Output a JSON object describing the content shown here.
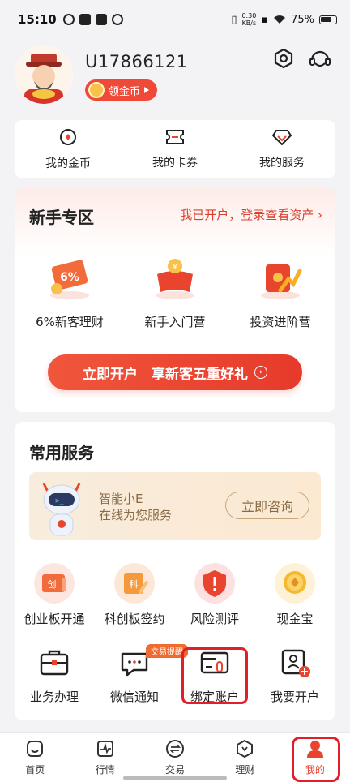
{
  "status_bar": {
    "time": "15:10",
    "net_speed_value": "0.30",
    "net_speed_unit": "KB/s",
    "battery": "75%"
  },
  "profile": {
    "username": "U17866121",
    "coin_badge_label": "领金币"
  },
  "quick_links": [
    {
      "label": "我的金币",
      "icon": "coin-target-icon"
    },
    {
      "label": "我的卡券",
      "icon": "ticket-icon"
    },
    {
      "label": "我的服务",
      "icon": "diamond-icon"
    }
  ],
  "newbie": {
    "title": "新手专区",
    "link": "我已开户，登录查看资产 ›",
    "features": [
      {
        "label": "6%新客理财",
        "icon": "percent-ticket-icon"
      },
      {
        "label": "新手入门营",
        "icon": "book-coin-icon"
      },
      {
        "label": "投资进阶营",
        "icon": "growth-envelope-icon"
      }
    ],
    "cta": "立即开户　享新客五重好礼"
  },
  "services": {
    "title": "常用服务",
    "assistant": {
      "line1": "智能小E",
      "line2": "在线为您服务",
      "button": "立即咨询"
    },
    "row1": [
      {
        "label": "创业板开通",
        "icon": "chuang-icon"
      },
      {
        "label": "科创板签约",
        "icon": "ke-icon"
      },
      {
        "label": "风险测评",
        "icon": "warning-shield-icon"
      },
      {
        "label": "现金宝",
        "icon": "gold-coin-icon"
      }
    ],
    "row2": [
      {
        "label": "业务办理",
        "icon": "briefcase-icon"
      },
      {
        "label": "微信通知",
        "icon": "chat-bubble-icon"
      },
      {
        "label": "绑定账户",
        "icon": "card-link-icon"
      },
      {
        "label": "我要开户",
        "icon": "add-user-icon"
      }
    ],
    "trade_tag": "交易提醒"
  },
  "tabs": [
    {
      "label": "首页",
      "icon": "home-icon"
    },
    {
      "label": "行情",
      "icon": "chart-icon"
    },
    {
      "label": "交易",
      "icon": "exchange-icon"
    },
    {
      "label": "理财",
      "icon": "wallet-icon"
    },
    {
      "label": "我的",
      "icon": "person-icon"
    }
  ],
  "colors": {
    "accent": "#e8442e",
    "highlight_box": "#e01f2b",
    "assistant_text": "#8a6a45"
  }
}
